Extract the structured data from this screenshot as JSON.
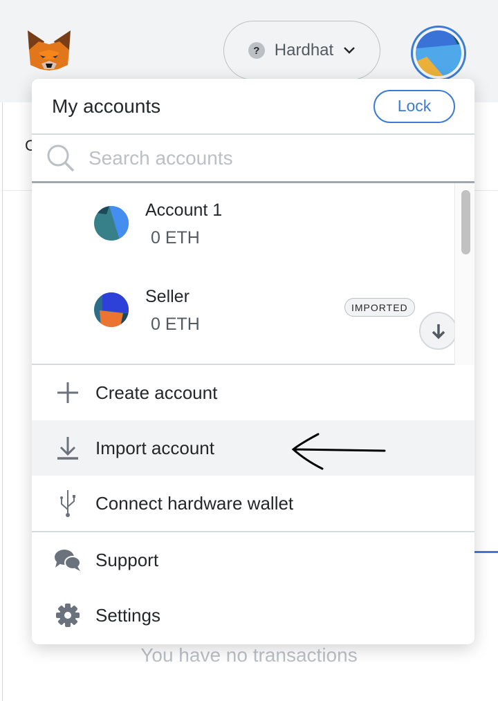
{
  "header": {
    "network": "Hardhat"
  },
  "background": {
    "partial_text": "C",
    "empty_state": "You have no transactions"
  },
  "menu": {
    "title": "My accounts",
    "lock_label": "Lock",
    "search": {
      "placeholder": "Search accounts",
      "value": ""
    },
    "accounts": [
      {
        "name": "Account 1",
        "balance": "0 ETH"
      },
      {
        "name": "Seller",
        "balance": "0 ETH",
        "badge": "IMPORTED"
      }
    ],
    "actions": [
      {
        "label": "Create account",
        "icon": "plus-icon"
      },
      {
        "label": "Import account",
        "icon": "download-icon"
      },
      {
        "label": "Connect hardware wallet",
        "icon": "usb-icon"
      }
    ],
    "footer": [
      {
        "label": "Support",
        "icon": "chat-bubbles-icon"
      },
      {
        "label": "Settings",
        "icon": "gear-icon"
      }
    ]
  },
  "colors": {
    "accent": "#3a7bd5",
    "header_bg": "#f2f3f4"
  }
}
